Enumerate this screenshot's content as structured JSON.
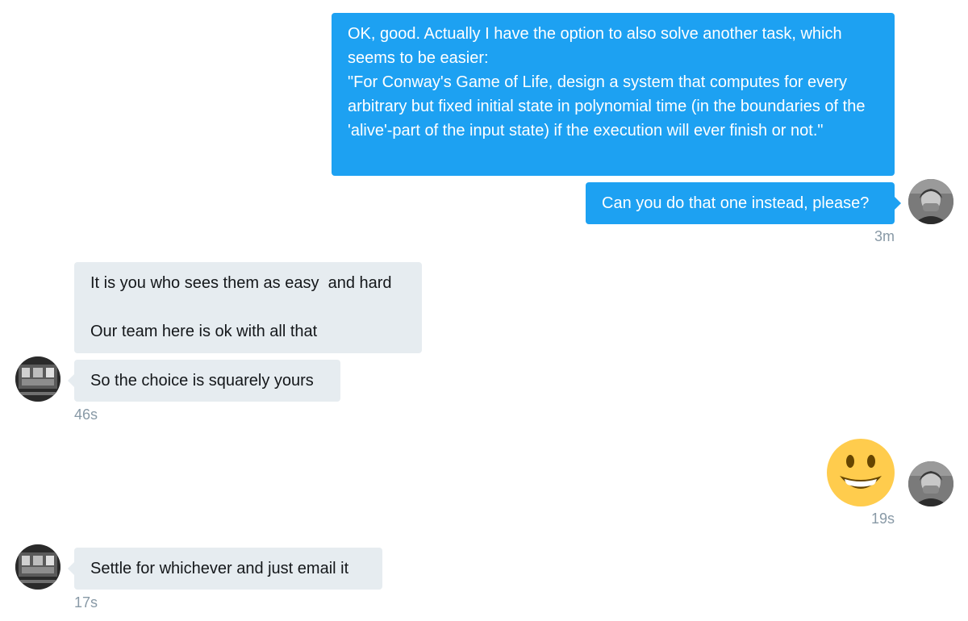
{
  "conversation": {
    "messages": [
      {
        "sender": "me",
        "text": "OK, good. Actually I have the option to also solve another task, which seems to be easier:\n\"For Conway's Game of Life, design a system that computes for every arbitrary but fixed initial state in polynomial time (in the boundaries of the 'alive'-part of the input state) if the execution will ever finish or not.\""
      },
      {
        "sender": "me",
        "text": "Can you do that one instead, please?",
        "time": "3m"
      },
      {
        "sender": "them",
        "text": "It is you who sees them as easy  and hard\n\nOur team here is ok with all that"
      },
      {
        "sender": "them",
        "text": "So the choice is squarely yours",
        "time": "46s"
      },
      {
        "sender": "me",
        "emoji": "smiling-face-emoji",
        "time": "19s"
      },
      {
        "sender": "them",
        "text": "Settle for whichever and just email it",
        "time": "17s"
      }
    ]
  },
  "colors": {
    "outgoing_bubble": "#1da1f2",
    "incoming_bubble": "#e6ecf0",
    "timestamp": "#8899a6",
    "emoji_face": "#ffcc4d"
  }
}
